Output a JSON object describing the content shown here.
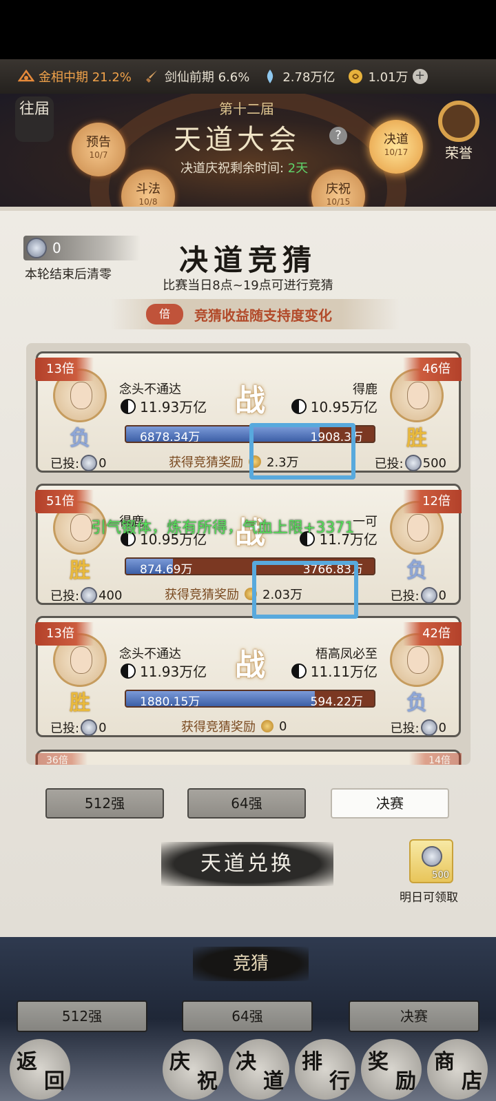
{
  "resources": [
    {
      "icon": "rank-icon",
      "label": "金相中期 21.2%",
      "highlight": true
    },
    {
      "icon": "sword-icon",
      "label": "剑仙前期 6.6%",
      "highlight": false
    },
    {
      "icon": "spirit-crystal-icon",
      "label": "2.78万亿",
      "highlight": false
    },
    {
      "icon": "coin-icon",
      "label": "1.01万",
      "highlight": false
    }
  ],
  "header": {
    "past_label": "往届",
    "round_label": "第十二届",
    "title": "天道大会",
    "help": "?",
    "countdown_prefix": "决道庆祝剩余时间: ",
    "countdown_value": "2天",
    "honor_label": "荣誉",
    "stages": [
      {
        "label": "预告",
        "date": "10/7"
      },
      {
        "label": "斗法",
        "date": "10/8"
      },
      {
        "label": "庆祝",
        "date": "10/15"
      },
      {
        "label": "决道",
        "date": "10/17"
      }
    ]
  },
  "panel": {
    "token_count": "0",
    "token_note": "本轮结束后清零",
    "title": "决道竞猜",
    "subtitle": "比赛当日8点~19点可进行竞猜",
    "ratio_tag": "倍",
    "ratio_text": "竞猜收益随支持度变化",
    "vs_char": "战",
    "bet_label": "已投:",
    "reward_label": "获得竞猜奖励"
  },
  "matches": [
    {
      "left": {
        "odds": "13倍",
        "name": "念头不通达",
        "power": "11.93万亿",
        "result": "负",
        "support": "6878.34万",
        "bet": "0"
      },
      "right": {
        "odds": "46倍",
        "name": "得鹿",
        "power": "10.95万亿",
        "result": "胜",
        "support": "1908.3万",
        "bet": "500"
      },
      "left_share": 0.78,
      "reward": "2.3万"
    },
    {
      "left": {
        "odds": "51倍",
        "name": "得鹿",
        "power": "10.95万亿",
        "result": "胜",
        "support": "874.69万",
        "bet": "400"
      },
      "right": {
        "odds": "12倍",
        "name": "一可",
        "power": "11.7万亿",
        "result": "负",
        "support": "3766.83万",
        "bet": "0"
      },
      "left_share": 0.19,
      "reward": "2.03万"
    },
    {
      "left": {
        "odds": "13倍",
        "name": "念头不通达",
        "power": "11.93万亿",
        "result": "胜",
        "support": "1880.15万",
        "bet": "0"
      },
      "right": {
        "odds": "42倍",
        "name": "梧高凤必至",
        "power": "11.11万亿",
        "result": "负",
        "support": "594.22万",
        "bet": "0"
      },
      "left_share": 0.76,
      "reward": "0"
    }
  ],
  "peek_odds": {
    "left": "36倍",
    "right": "14倍"
  },
  "float_message": "引气锻体，炼有所得，气血上限+3371",
  "round_tabs": [
    "512强",
    "64强",
    "决赛"
  ],
  "exchange_label": "天道兑换",
  "daily_reward": {
    "count": "500",
    "note": "明日可领取"
  },
  "bottom": {
    "title": "竞猜",
    "tabs": [
      "512强",
      "64强",
      "决赛"
    ],
    "nav": [
      {
        "c1": "返",
        "c2": "回"
      },
      {
        "c1": "庆",
        "c2": "祝"
      },
      {
        "c1": "决",
        "c2": "道"
      },
      {
        "c1": "排",
        "c2": "行"
      },
      {
        "c1": "奖",
        "c2": "励"
      },
      {
        "c1": "商",
        "c2": "店"
      }
    ]
  },
  "colors": {
    "highlight_box": "#58a9dd",
    "win": "#e8b93d",
    "lose": "#8ea6d6",
    "float_text": "#58e05c"
  }
}
